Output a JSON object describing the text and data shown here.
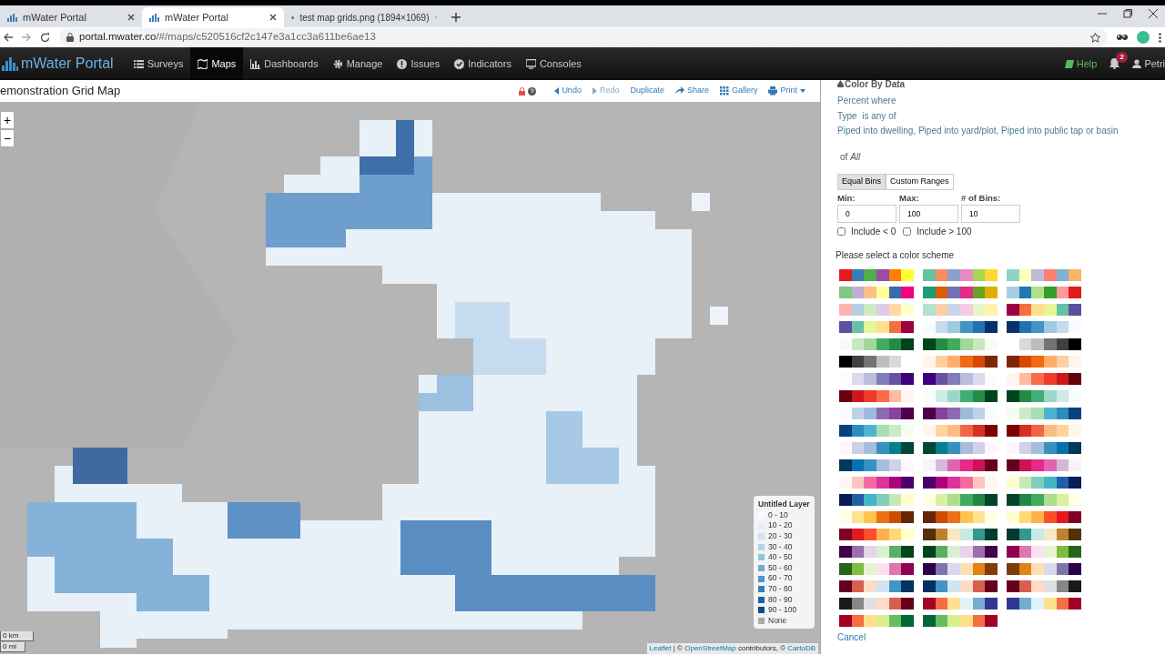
{
  "browser": {
    "tabs": [
      {
        "title": "mWater Portal",
        "selected": false,
        "kind": "app"
      },
      {
        "title": "mWater Portal",
        "selected": true,
        "kind": "app"
      },
      {
        "title": "test map grids.png (1894×1069)",
        "selected": false,
        "kind": "web"
      }
    ],
    "address": {
      "host": "portal.mwater.co",
      "path": "/#/maps/c520516cf2c147e3a1cc3a611be6ae13"
    }
  },
  "navbar": {
    "brand": "mWater Portal",
    "items": [
      {
        "label": "Surveys",
        "selected": false
      },
      {
        "label": "Maps",
        "selected": true
      },
      {
        "label": "Dashboards",
        "selected": false
      },
      {
        "label": "Manage",
        "selected": false
      },
      {
        "label": "Issues",
        "selected": false
      },
      {
        "label": "Indicators",
        "selected": false
      },
      {
        "label": "Consoles",
        "selected": false
      }
    ],
    "help": "Help",
    "notifications": "2",
    "user": "Petri"
  },
  "map": {
    "title": "emonstration Grid Map",
    "toolbar": [
      {
        "label": "Undo",
        "disabled": false
      },
      {
        "label": "Redo",
        "disabled": true
      },
      {
        "label": "Duplicate",
        "disabled": false
      },
      {
        "label": "Share",
        "disabled": false
      },
      {
        "label": "Gallery",
        "disabled": false
      },
      {
        "label": "Print",
        "disabled": false
      }
    ],
    "zoom_in": "+",
    "zoom_out": "−",
    "scale": [
      "0 km",
      "0 mi"
    ],
    "legend": {
      "title": "Untitled Layer",
      "items": [
        {
          "label": "0 - 10",
          "color": "#f7fbff"
        },
        {
          "label": "10 - 20",
          "color": "#e3eef9"
        },
        {
          "label": "20 - 30",
          "color": "#cfe1f2"
        },
        {
          "label": "30 - 40",
          "color": "#b5d4e9"
        },
        {
          "label": "40 - 50",
          "color": "#93c3df"
        },
        {
          "label": "50 - 60",
          "color": "#6daed5"
        },
        {
          "label": "60 - 70",
          "color": "#4b97c9"
        },
        {
          "label": "70 - 80",
          "color": "#2f7ebc"
        },
        {
          "label": "80 - 90",
          "color": "#1864aa"
        },
        {
          "label": "90 - 100",
          "color": "#0a4a90"
        },
        {
          "label": "None",
          "color": "#aaaaaa"
        }
      ]
    },
    "attribution": {
      "leaflet": "Leaflet",
      "text1": "| ©",
      "osm": "OpenStreetMap",
      "text2": "contributors, ©",
      "carto": "CartoDB"
    }
  },
  "panel": {
    "heading": "Color By Data",
    "lines": [
      "Percent where",
      "Type  is any of",
      "Piped into dwelling, Piped into yard/plot, Piped into public tap or basin"
    ],
    "of": "of *All*",
    "modes": [
      {
        "label": "Equal Bins",
        "selected": true
      },
      {
        "label": "Custom Ranges",
        "selected": false
      }
    ],
    "fields": [
      {
        "label": "Min:",
        "value": "0"
      },
      {
        "label": "Max:",
        "value": "100"
      },
      {
        "label": "# of Bins:",
        "value": "10"
      }
    ],
    "checks": [
      {
        "label": "Include < 0",
        "checked": false
      },
      {
        "label": "Include > 100",
        "checked": false
      }
    ],
    "prompt": "Please select a color scheme",
    "color_schemes": [
      {
        "swatches": [
          {
            "color": "#e41a1c"
          },
          {
            "color": "#377eb8"
          },
          {
            "color": "#4daf4a"
          },
          {
            "color": "#984ea3"
          },
          {
            "color": "#ff7f00"
          },
          {
            "color": "#ffff33"
          }
        ]
      },
      {
        "swatches": [
          {
            "color": "#66c2a5"
          },
          {
            "color": "#fc8d62"
          },
          {
            "color": "#8da0cb"
          },
          {
            "color": "#e78ac3"
          },
          {
            "color": "#a6d854"
          },
          {
            "color": "#ffd92f"
          }
        ]
      },
      {
        "swatches": [
          {
            "color": "#8dd3c7"
          },
          {
            "color": "#ffffb3"
          },
          {
            "color": "#bebada"
          },
          {
            "color": "#fb8072"
          },
          {
            "color": "#80b1d3"
          },
          {
            "color": "#fdb462"
          }
        ]
      },
      {
        "swatches": [
          {
            "color": "#7fc97f"
          },
          {
            "color": "#beaed4"
          },
          {
            "color": "#fdc086"
          },
          {
            "color": "#ffff99"
          },
          {
            "color": "#386cb0"
          },
          {
            "color": "#f0027f"
          }
        ]
      },
      {
        "swatches": [
          {
            "color": "#1b9e77"
          },
          {
            "color": "#d95f02"
          },
          {
            "color": "#7570b3"
          },
          {
            "color": "#e7298a"
          },
          {
            "color": "#66a61e"
          },
          {
            "color": "#e6ab02"
          }
        ]
      },
      {
        "swatches": [
          {
            "color": "#a6cee3"
          },
          {
            "color": "#1f78b4"
          },
          {
            "color": "#b2df8a"
          },
          {
            "color": "#33a02c"
          },
          {
            "color": "#fb9a99"
          },
          {
            "color": "#e31a1c"
          }
        ]
      },
      {
        "swatches": [
          {
            "color": "#fbb4ae"
          },
          {
            "color": "#b3cde3"
          },
          {
            "color": "#ccebc5"
          },
          {
            "color": "#decbe4"
          },
          {
            "color": "#fed9a6"
          },
          {
            "color": "#ffffcc"
          }
        ]
      },
      {
        "swatches": [
          {
            "color": "#b3e2cd"
          },
          {
            "color": "#fdcdac"
          },
          {
            "color": "#cbd5e8"
          },
          {
            "color": "#f4cae4"
          },
          {
            "color": "#e6f5c9"
          },
          {
            "color": "#fff2ae"
          }
        ]
      },
      {
        "swatches": [
          {
            "color": "#9e0142"
          },
          {
            "color": "#f46d43"
          },
          {
            "color": "#fee08b"
          },
          {
            "color": "#e6f598"
          },
          {
            "color": "#66c2a5"
          },
          {
            "color": "#5e4fa2"
          }
        ]
      },
      {
        "swatches": [
          {
            "color": "#5e4fa2"
          },
          {
            "color": "#66c2a5"
          },
          {
            "color": "#e6f598"
          },
          {
            "color": "#fee08b"
          },
          {
            "color": "#f46d43"
          },
          {
            "color": "#9e0142"
          }
        ]
      },
      {
        "swatches": [
          {
            "color": "#f7fbff"
          },
          {
            "color": "#c6dbef"
          },
          {
            "color": "#9ecae1"
          },
          {
            "color": "#4292c6"
          },
          {
            "color": "#2171b5"
          },
          {
            "color": "#08306b"
          }
        ]
      },
      {
        "swatches": [
          {
            "color": "#08306b"
          },
          {
            "color": "#2171b5"
          },
          {
            "color": "#4292c6"
          },
          {
            "color": "#9ecae1"
          },
          {
            "color": "#c6dbef"
          },
          {
            "color": "#f7fbff"
          }
        ]
      },
      {
        "swatches": [
          {
            "color": "#f7fcf5"
          },
          {
            "color": "#c7e9c0"
          },
          {
            "color": "#a1d99b"
          },
          {
            "color": "#41ab5d"
          },
          {
            "color": "#238b45"
          },
          {
            "color": "#00441b"
          }
        ]
      },
      {
        "swatches": [
          {
            "color": "#00441b"
          },
          {
            "color": "#238b45"
          },
          {
            "color": "#41ab5d"
          },
          {
            "color": "#a1d99b"
          },
          {
            "color": "#c7e9c0"
          },
          {
            "color": "#f7fcf5"
          }
        ]
      },
      {
        "swatches": [
          {
            "color": "#ffffff"
          },
          {
            "color": "#d9d9d9"
          },
          {
            "color": "#bdbdbd"
          },
          {
            "color": "#737373"
          },
          {
            "color": "#404040"
          },
          {
            "color": "#000000"
          }
        ]
      },
      {
        "swatches": [
          {
            "color": "#000000"
          },
          {
            "color": "#404040"
          },
          {
            "color": "#737373"
          },
          {
            "color": "#bdbdbd"
          },
          {
            "color": "#d9d9d9"
          },
          {
            "color": "#ffffff"
          }
        ]
      },
      {
        "swatches": [
          {
            "color": "#fff5eb"
          },
          {
            "color": "#fdd0a2"
          },
          {
            "color": "#fdae6b"
          },
          {
            "color": "#f16913"
          },
          {
            "color": "#d94801"
          },
          {
            "color": "#7f2704"
          }
        ]
      },
      {
        "swatches": [
          {
            "color": "#7f2704"
          },
          {
            "color": "#d94801"
          },
          {
            "color": "#f16913"
          },
          {
            "color": "#fdae6b"
          },
          {
            "color": "#fdd0a2"
          },
          {
            "color": "#fff5eb"
          }
        ]
      },
      {
        "swatches": [
          {
            "color": "#fcfbfd"
          },
          {
            "color": "#dadaeb"
          },
          {
            "color": "#bcbddc"
          },
          {
            "color": "#807dba"
          },
          {
            "color": "#6a51a3"
          },
          {
            "color": "#3f007d"
          }
        ]
      },
      {
        "swatches": [
          {
            "color": "#3f007d"
          },
          {
            "color": "#6a51a3"
          },
          {
            "color": "#807dba"
          },
          {
            "color": "#bcbddc"
          },
          {
            "color": "#dadaeb"
          },
          {
            "color": "#fcfbfd"
          }
        ]
      },
      {
        "swatches": [
          {
            "color": "#fff5f0"
          },
          {
            "color": "#fcbba1"
          },
          {
            "color": "#fb6a4a"
          },
          {
            "color": "#ef3b2c"
          },
          {
            "color": "#cb181d"
          },
          {
            "color": "#67000d"
          }
        ]
      },
      {
        "swatches": [
          {
            "color": "#67000d"
          },
          {
            "color": "#cb181d"
          },
          {
            "color": "#ef3b2c"
          },
          {
            "color": "#fb6a4a"
          },
          {
            "color": "#fcbba1"
          },
          {
            "color": "#fff5f0"
          }
        ]
      },
      {
        "swatches": [
          {
            "color": "#f7fcfd"
          },
          {
            "color": "#ccece6"
          },
          {
            "color": "#99d8c9"
          },
          {
            "color": "#41ae76"
          },
          {
            "color": "#238b45"
          },
          {
            "color": "#00441b"
          }
        ]
      },
      {
        "swatches": [
          {
            "color": "#00441b"
          },
          {
            "color": "#238b45"
          },
          {
            "color": "#41ae76"
          },
          {
            "color": "#99d8c9"
          },
          {
            "color": "#ccece6"
          },
          {
            "color": "#f7fcfd"
          }
        ]
      },
      {
        "swatches": [
          {
            "color": "#f7fcfd"
          },
          {
            "color": "#bfd3e6"
          },
          {
            "color": "#9ebcda"
          },
          {
            "color": "#8c6bb1"
          },
          {
            "color": "#88419d"
          },
          {
            "color": "#4d004b"
          }
        ]
      },
      {
        "swatches": [
          {
            "color": "#4d004b"
          },
          {
            "color": "#88419d"
          },
          {
            "color": "#8c6bb1"
          },
          {
            "color": "#9ebcda"
          },
          {
            "color": "#bfd3e6"
          },
          {
            "color": "#f7fcfd"
          }
        ]
      },
      {
        "swatches": [
          {
            "color": "#f7fcf0"
          },
          {
            "color": "#ccebc5"
          },
          {
            "color": "#a8ddb5"
          },
          {
            "color": "#4eb3d3"
          },
          {
            "color": "#2b8cbe"
          },
          {
            "color": "#084081"
          }
        ]
      },
      {
        "swatches": [
          {
            "color": "#084081"
          },
          {
            "color": "#2b8cbe"
          },
          {
            "color": "#4eb3d3"
          },
          {
            "color": "#a8ddb5"
          },
          {
            "color": "#ccebc5"
          },
          {
            "color": "#f7fcf0"
          }
        ]
      },
      {
        "swatches": [
          {
            "color": "#fff7ec"
          },
          {
            "color": "#fdd49e"
          },
          {
            "color": "#fdbb84"
          },
          {
            "color": "#ef6548"
          },
          {
            "color": "#d7301f"
          },
          {
            "color": "#7f0000"
          }
        ]
      },
      {
        "swatches": [
          {
            "color": "#7f0000"
          },
          {
            "color": "#d7301f"
          },
          {
            "color": "#ef6548"
          },
          {
            "color": "#fdbb84"
          },
          {
            "color": "#fdd49e"
          },
          {
            "color": "#fff7ec"
          }
        ]
      },
      {
        "swatches": [
          {
            "color": "#fff7fb"
          },
          {
            "color": "#d0d1e6"
          },
          {
            "color": "#a6bddb"
          },
          {
            "color": "#3690c0"
          },
          {
            "color": "#02818a"
          },
          {
            "color": "#014636"
          }
        ]
      },
      {
        "swatches": [
          {
            "color": "#014636"
          },
          {
            "color": "#02818a"
          },
          {
            "color": "#3690c0"
          },
          {
            "color": "#a6bddb"
          },
          {
            "color": "#d0d1e6"
          },
          {
            "color": "#fff7fb"
          }
        ]
      },
      {
        "swatches": [
          {
            "color": "#fff7fb"
          },
          {
            "color": "#d0d1e6"
          },
          {
            "color": "#a6bddb"
          },
          {
            "color": "#3690c0"
          },
          {
            "color": "#0570b0"
          },
          {
            "color": "#023858"
          }
        ]
      },
      {
        "swatches": [
          {
            "color": "#023858"
          },
          {
            "color": "#0570b0"
          },
          {
            "color": "#3690c0"
          },
          {
            "color": "#a6bddb"
          },
          {
            "color": "#d0d1e6"
          },
          {
            "color": "#fff7fb"
          }
        ]
      },
      {
        "swatches": [
          {
            "color": "#f7f4f9"
          },
          {
            "color": "#d4b9da"
          },
          {
            "color": "#df65b0"
          },
          {
            "color": "#e7298a"
          },
          {
            "color": "#ce1256"
          },
          {
            "color": "#67001f"
          }
        ]
      },
      {
        "swatches": [
          {
            "color": "#67001f"
          },
          {
            "color": "#ce1256"
          },
          {
            "color": "#e7298a"
          },
          {
            "color": "#df65b0"
          },
          {
            "color": "#d4b9da"
          },
          {
            "color": "#f7f4f9"
          }
        ]
      },
      {
        "swatches": [
          {
            "color": "#fff7f3"
          },
          {
            "color": "#fcc5c0"
          },
          {
            "color": "#f768a1"
          },
          {
            "color": "#dd3497"
          },
          {
            "color": "#ae017e"
          },
          {
            "color": "#49006a"
          }
        ]
      },
      {
        "swatches": [
          {
            "color": "#49006a"
          },
          {
            "color": "#ae017e"
          },
          {
            "color": "#dd3497"
          },
          {
            "color": "#f768a1"
          },
          {
            "color": "#fcc5c0"
          },
          {
            "color": "#fff7f3"
          }
        ]
      },
      {
        "swatches": [
          {
            "color": "#ffffcc"
          },
          {
            "color": "#c7e9b4"
          },
          {
            "color": "#7fcdbb"
          },
          {
            "color": "#41b6c4"
          },
          {
            "color": "#225ea8"
          },
          {
            "color": "#081d58"
          }
        ]
      },
      {
        "swatches": [
          {
            "color": "#081d58"
          },
          {
            "color": "#225ea8"
          },
          {
            "color": "#41b6c4"
          },
          {
            "color": "#7fcdbb"
          },
          {
            "color": "#c7e9b4"
          },
          {
            "color": "#ffffcc"
          }
        ]
      },
      {
        "swatches": [
          {
            "color": "#ffffe5"
          },
          {
            "color": "#d9f0a3"
          },
          {
            "color": "#addd8e"
          },
          {
            "color": "#41ab5d"
          },
          {
            "color": "#238443"
          },
          {
            "color": "#004529"
          }
        ]
      },
      {
        "swatches": [
          {
            "color": "#004529"
          },
          {
            "color": "#238443"
          },
          {
            "color": "#41ab5d"
          },
          {
            "color": "#addd8e"
          },
          {
            "color": "#d9f0a3"
          },
          {
            "color": "#ffffe5"
          }
        ]
      },
      {
        "swatches": [
          {
            "color": "#ffffe5"
          },
          {
            "color": "#fee391"
          },
          {
            "color": "#fec44f"
          },
          {
            "color": "#ec7014"
          },
          {
            "color": "#cc4c02"
          },
          {
            "color": "#662506"
          }
        ]
      },
      {
        "swatches": [
          {
            "color": "#662506"
          },
          {
            "color": "#cc4c02"
          },
          {
            "color": "#ec7014"
          },
          {
            "color": "#fec44f"
          },
          {
            "color": "#fee391"
          },
          {
            "color": "#ffffe5"
          }
        ]
      },
      {
        "swatches": [
          {
            "color": "#ffffcc"
          },
          {
            "color": "#fed976"
          },
          {
            "color": "#feb24c"
          },
          {
            "color": "#fc4e2a"
          },
          {
            "color": "#e31a1c"
          },
          {
            "color": "#800026"
          }
        ]
      },
      {
        "swatches": [
          {
            "color": "#800026"
          },
          {
            "color": "#e31a1c"
          },
          {
            "color": "#fc4e2a"
          },
          {
            "color": "#feb24c"
          },
          {
            "color": "#fed976"
          },
          {
            "color": "#ffffcc"
          }
        ]
      },
      {
        "swatches": [
          {
            "color": "#543005"
          },
          {
            "color": "#bf812d"
          },
          {
            "color": "#f6e8c3"
          },
          {
            "color": "#c7eae5"
          },
          {
            "color": "#35978f"
          },
          {
            "color": "#003c30"
          }
        ]
      },
      {
        "swatches": [
          {
            "color": "#003c30"
          },
          {
            "color": "#35978f"
          },
          {
            "color": "#c7eae5"
          },
          {
            "color": "#f6e8c3"
          },
          {
            "color": "#bf812d"
          },
          {
            "color": "#543005"
          }
        ]
      },
      {
        "swatches": [
          {
            "color": "#40004b"
          },
          {
            "color": "#9970ab"
          },
          {
            "color": "#e7d4e8"
          },
          {
            "color": "#d9f0d3"
          },
          {
            "color": "#5aae61"
          },
          {
            "color": "#00441b"
          }
        ]
      },
      {
        "swatches": [
          {
            "color": "#00441b"
          },
          {
            "color": "#5aae61"
          },
          {
            "color": "#d9f0d3"
          },
          {
            "color": "#e7d4e8"
          },
          {
            "color": "#9970ab"
          },
          {
            "color": "#40004b"
          }
        ]
      },
      {
        "swatches": [
          {
            "color": "#8e0152"
          },
          {
            "color": "#de77ae"
          },
          {
            "color": "#fde0ef"
          },
          {
            "color": "#e6f5d0"
          },
          {
            "color": "#7fbc41"
          },
          {
            "color": "#276419"
          }
        ]
      },
      {
        "swatches": [
          {
            "color": "#276419"
          },
          {
            "color": "#7fbc41"
          },
          {
            "color": "#e6f5d0"
          },
          {
            "color": "#fde0ef"
          },
          {
            "color": "#de77ae"
          },
          {
            "color": "#8e0152"
          }
        ]
      },
      {
        "swatches": [
          {
            "color": "#2d004b"
          },
          {
            "color": "#8073ac"
          },
          {
            "color": "#d8daeb"
          },
          {
            "color": "#fee0b6"
          },
          {
            "color": "#e08214"
          },
          {
            "color": "#7f3b08"
          }
        ]
      },
      {
        "swatches": [
          {
            "color": "#7f3b08"
          },
          {
            "color": "#e08214"
          },
          {
            "color": "#fee0b6"
          },
          {
            "color": "#d8daeb"
          },
          {
            "color": "#8073ac"
          },
          {
            "color": "#2d004b"
          }
        ]
      },
      {
        "swatches": [
          {
            "color": "#67001f"
          },
          {
            "color": "#d6604d"
          },
          {
            "color": "#fddbc7"
          },
          {
            "color": "#d1e5f0"
          },
          {
            "color": "#4393c3"
          },
          {
            "color": "#053061"
          }
        ]
      },
      {
        "swatches": [
          {
            "color": "#053061"
          },
          {
            "color": "#4393c3"
          },
          {
            "color": "#d1e5f0"
          },
          {
            "color": "#fddbc7"
          },
          {
            "color": "#d6604d"
          },
          {
            "color": "#67001f"
          }
        ]
      },
      {
        "swatches": [
          {
            "color": "#67001f"
          },
          {
            "color": "#d6604d"
          },
          {
            "color": "#fddbc7"
          },
          {
            "color": "#e0e0e0"
          },
          {
            "color": "#878787"
          },
          {
            "color": "#1a1a1a"
          }
        ]
      },
      {
        "swatches": [
          {
            "color": "#1a1a1a"
          },
          {
            "color": "#878787"
          },
          {
            "color": "#e0e0e0"
          },
          {
            "color": "#fddbc7"
          },
          {
            "color": "#d6604d"
          },
          {
            "color": "#67001f"
          }
        ]
      },
      {
        "swatches": [
          {
            "color": "#a50026"
          },
          {
            "color": "#f46d43"
          },
          {
            "color": "#fee090"
          },
          {
            "color": "#e0f3f8"
          },
          {
            "color": "#74add1"
          },
          {
            "color": "#313695"
          }
        ]
      },
      {
        "swatches": [
          {
            "color": "#313695"
          },
          {
            "color": "#74add1"
          },
          {
            "color": "#e0f3f8"
          },
          {
            "color": "#fee090"
          },
          {
            "color": "#f46d43"
          },
          {
            "color": "#a50026"
          }
        ]
      },
      {
        "swatches": [
          {
            "color": "#a50026"
          },
          {
            "color": "#f46d43"
          },
          {
            "color": "#fee08b"
          },
          {
            "color": "#d9ef8b"
          },
          {
            "color": "#66bd63"
          },
          {
            "color": "#006837"
          }
        ]
      },
      {
        "swatches": [
          {
            "color": "#006837"
          },
          {
            "color": "#66bd63"
          },
          {
            "color": "#d9ef8b"
          },
          {
            "color": "#fee08b"
          },
          {
            "color": "#f46d43"
          },
          {
            "color": "#a50026"
          }
        ]
      }
    ],
    "cancel": "Cancel"
  }
}
